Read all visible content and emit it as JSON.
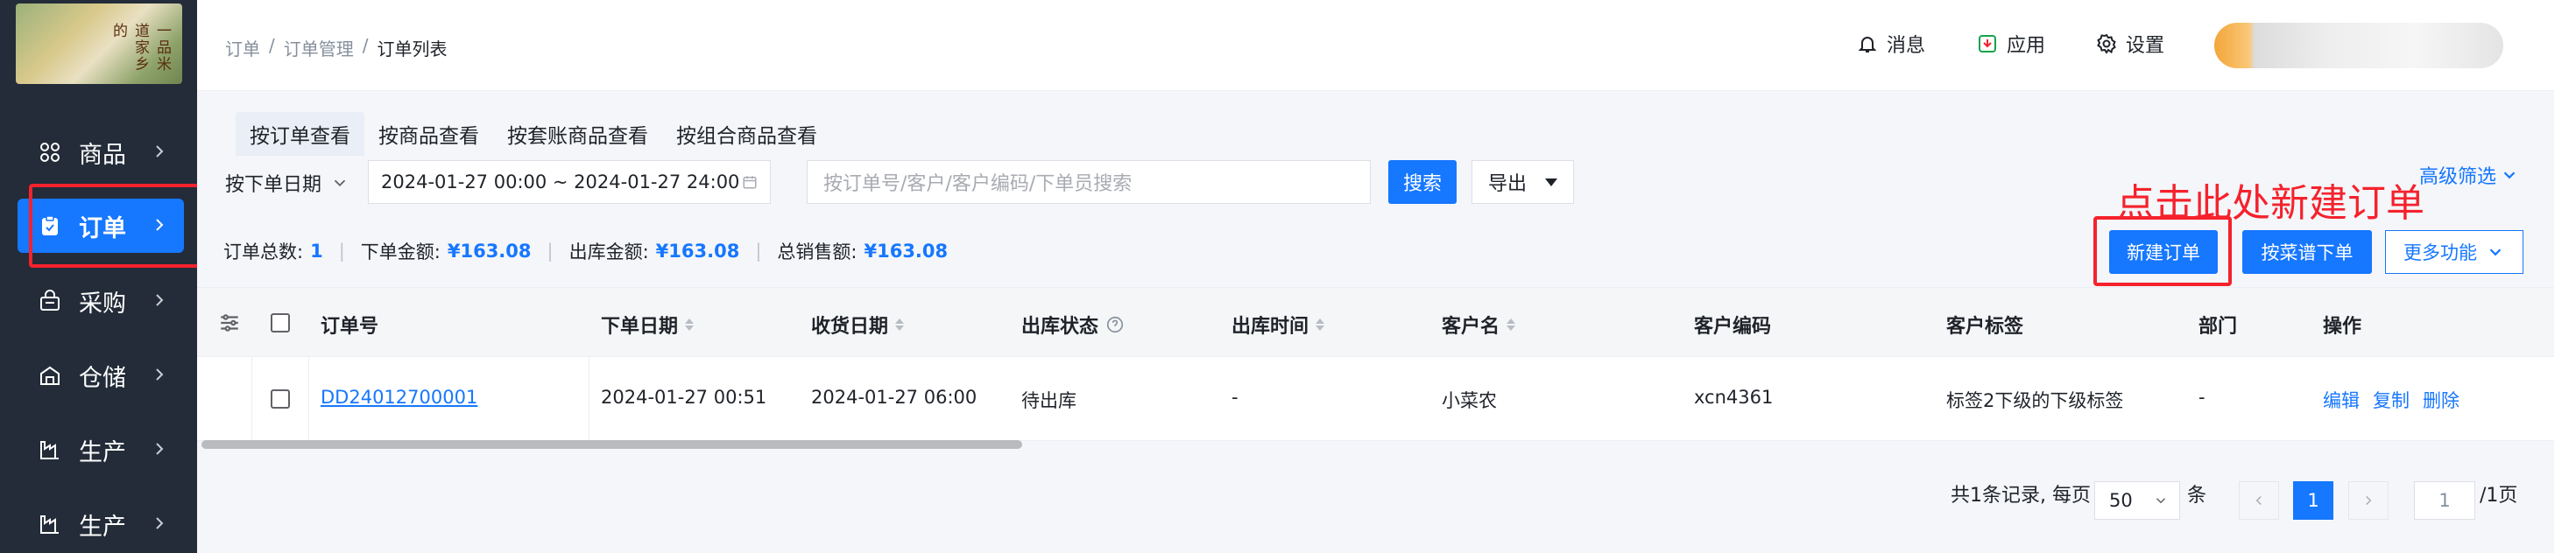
{
  "sidebar": {
    "logo_text": "一品米道家乡的",
    "items": [
      {
        "label": "商品",
        "icon": "grid-icon"
      },
      {
        "label": "订单",
        "icon": "clipboard-icon"
      },
      {
        "label": "采购",
        "icon": "basket-icon"
      },
      {
        "label": "仓储",
        "icon": "warehouse-icon"
      },
      {
        "label": "生产",
        "icon": "factory-icon"
      },
      {
        "label": "生产",
        "icon": "factory-icon"
      }
    ]
  },
  "breadcrumb": [
    "订单",
    "/",
    "订单管理",
    "/",
    "订单列表"
  ],
  "topbar": {
    "messages": "消息",
    "apps": "应用",
    "settings": "设置"
  },
  "tabs": [
    "按订单查看",
    "按商品查看",
    "按套账商品查看",
    "按组合商品查看"
  ],
  "filter": {
    "date_type": "按下单日期",
    "date_range": "2024-01-27 00:00 ~ 2024-01-27 24:00",
    "search_placeholder": "按订单号/客户/客户编码/下单员搜索",
    "search_button": "搜索",
    "export_button": "导出",
    "advanced": "高级筛选"
  },
  "summary": {
    "total_orders_label": "订单总数:",
    "total_orders": "1",
    "order_amount_label": "下单金额:",
    "order_amount": "¥163.08",
    "outbound_amount_label": "出库金额:",
    "outbound_amount": "¥163.08",
    "total_sales_label": "总销售额:",
    "total_sales": "¥163.08",
    "separator": "|"
  },
  "actions": {
    "new_order": "新建订单",
    "recipe_order": "按菜谱下单",
    "more": "更多功能"
  },
  "annotation": "点击此处新建订单",
  "table": {
    "columns": [
      "订单号",
      "下单日期",
      "收货日期",
      "出库状态",
      "出库时间",
      "客户名",
      "客户编码",
      "客户标签",
      "部门",
      "操作"
    ],
    "rows": [
      {
        "order_no": "DD24012700001",
        "order_date": "2024-01-27 00:51",
        "delivery_date": "2024-01-27 06:00",
        "outbound_status": "待出库",
        "outbound_time": "-",
        "customer_name": "小菜农",
        "customer_code": "xcn4361",
        "customer_tag": "标签2下级的下级标签",
        "department": "-",
        "ops": [
          "编辑",
          "复制",
          "删除"
        ]
      }
    ]
  },
  "pagination": {
    "total_text": "共1条记录, 每页",
    "page_size": "50",
    "per_unit": "条",
    "current_page": "1",
    "goto_value": "1",
    "total_pages": "/1页"
  },
  "colors": {
    "primary": "#1677ff",
    "sidebar_bg": "#232c38",
    "annotation": "#f5222d"
  }
}
